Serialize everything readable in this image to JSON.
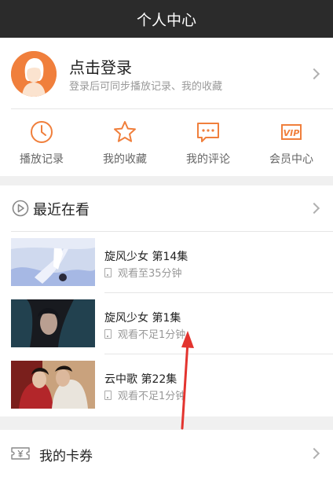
{
  "header": {
    "title": "个人中心"
  },
  "profile": {
    "login_title": "点击登录",
    "login_subtitle": "登录后可同步播放记录、我的收藏",
    "accent_color": "#f07f3c"
  },
  "quick_actions": [
    {
      "label": "播放记录",
      "icon": "clock-icon"
    },
    {
      "label": "我的收藏",
      "icon": "star-icon"
    },
    {
      "label": "我的评论",
      "icon": "comment-icon"
    },
    {
      "label": "会员中心",
      "icon": "vip-icon"
    }
  ],
  "recent": {
    "title": "最近在看",
    "items": [
      {
        "title": "旋风少女 第14集",
        "progress": "观看至35分钟"
      },
      {
        "title": "旋风少女 第1集",
        "progress": "观看不足1分钟"
      },
      {
        "title": "云中歌 第22集",
        "progress": "观看不足1分钟"
      }
    ]
  },
  "cards": {
    "title": "我的卡券",
    "icon": "coupon-icon"
  },
  "annotation": {
    "color": "#e3342f"
  }
}
